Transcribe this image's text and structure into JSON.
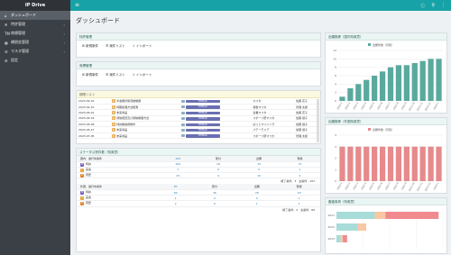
{
  "app": {
    "brand": "IP Drive"
  },
  "sidebar": {
    "items": [
      {
        "icon": "⌂",
        "label": "ダッシュボード",
        "active": true,
        "chevron": false
      },
      {
        "icon": "✉",
        "label": "特許管理",
        "active": false,
        "chevron": true
      },
      {
        "icon": "TM",
        "label": "商標管理",
        "active": false,
        "chevron": true
      },
      {
        "icon": "▦",
        "label": "補償金管理",
        "active": false,
        "chevron": true
      },
      {
        "icon": "☰",
        "label": "マスタ管理",
        "active": false,
        "chevron": true
      },
      {
        "icon": "⚙",
        "label": "設定",
        "active": false,
        "chevron": false
      }
    ]
  },
  "topbar": {
    "menu_icon": "≡",
    "icons": [
      "ⓘ",
      "♀",
      "⋮"
    ]
  },
  "page": {
    "title": "ダッシュボード"
  },
  "patent_panel": {
    "title": "特許管理",
    "links": [
      "新規案件",
      "案件リスト",
      "インポート"
    ]
  },
  "trademark_panel": {
    "title": "商標管理",
    "links": [
      "新規案件",
      "案件リスト",
      "インポート"
    ]
  },
  "deadline_panel": {
    "title": "期限リスト",
    "rows": [
      {
        "date": "2023-02-01",
        "name": "半金属状態流動制御",
        "code": "TRYMAR",
        "person": "マスタ",
        "owner": "佐藤 花子"
      },
      {
        "date": "2023-02-10",
        "name": "特願処理方法観測",
        "code": "TRYMAR",
        "person": "報告マスタ",
        "owner": "管理 太郎"
      },
      {
        "date": "2023-04-01",
        "name": "未来商品",
        "code": "TRYMAR",
        "person": "企業マスタ",
        "owner": "佐藤 花子"
      },
      {
        "date": "2023-04-16",
        "name": "通信装置及び通信制御方法",
        "code": "TRYMAR",
        "person": "スポーツ研マスタ",
        "owner": "加藤 健子"
      },
      {
        "date": "2023-05-06",
        "name": "特許推進用物件",
        "code": "TRYMAR",
        "person": "ぱっとマイニング",
        "owner": "加藤 健子"
      },
      {
        "date": "2023-05-27",
        "name": "未来商品",
        "code": "TRYMAR",
        "person": "パテーモミア",
        "owner": "加藤 健子"
      },
      {
        "date": "2023-07-05",
        "name": "未来商品",
        "code": "TRYMAR",
        "person": "スポーツ研マスタ",
        "owner": "管理 太郎"
      }
    ]
  },
  "status_panel": {
    "title": "ステータス別件数（特実意）",
    "domestic": {
      "header": {
        "label": "国内：進行中案件",
        "total": "193",
        "c1": "受付",
        "c2": "出願",
        "c3": "登録"
      },
      "rows": [
        {
          "tag": "B",
          "tag_color": "#7a5fb8",
          "label": "特許",
          "total": "169",
          "c1": "18",
          "c2": "79",
          "c3": "72"
        },
        {
          "tag": "J",
          "tag_color": "#e6a23c",
          "label": "実案",
          "total": "1",
          "c1": "0",
          "c2": "0",
          "c3": "1"
        },
        {
          "tag": "D",
          "tag_color": "#e67e22",
          "label": "意匠",
          "total": "23",
          "c1": "4",
          "c2": "15",
          "c3": "4"
        }
      ],
      "footer": "終了案件：3　全案件：197"
    },
    "foreign": {
      "header": {
        "label": "外国：進行中案件",
        "total": "87",
        "c1": "受付",
        "c2": "出願",
        "c3": "登録"
      },
      "rows": [
        {
          "tag": "B",
          "tag_color": "#7a5fb8",
          "label": "特許",
          "total": "84",
          "c1": "36",
          "c2": "28",
          "c3": "18"
        },
        {
          "tag": "J",
          "tag_color": "#e6a23c",
          "label": "実案",
          "total": "1",
          "c1": "0",
          "c2": "0",
          "c3": "1"
        },
        {
          "tag": "D",
          "tag_color": "#e67e22",
          "label": "意匠",
          "total": "2",
          "c1": "0",
          "c2": "1",
          "c3": "1"
        }
      ],
      "footer": "終了案件：2　全案件：89"
    }
  },
  "chart1_panel": {
    "title": "出願推移（国内特実意）"
  },
  "chart2_panel": {
    "title": "出願推移（外国特実意）"
  },
  "chart3_panel": {
    "title": "審査負荷（特実意）"
  },
  "chart_data": [
    {
      "type": "bar",
      "title": "出願推移（国内特実意）",
      "legend": "出願件数（月別）",
      "categories": [
        "2022-1",
        "2022-2",
        "2022-3",
        "2022-4",
        "2022-5",
        "2022-6",
        "2022-7",
        "2022-8",
        "2022-9",
        "2022-10",
        "2022-11",
        "2022-12",
        "2023-1"
      ],
      "values": [
        1,
        3,
        4,
        5,
        6,
        7,
        8,
        8.5,
        8.5,
        9,
        9.5,
        10,
        10
      ],
      "ylim": [
        0,
        12
      ],
      "yticks": [
        "0",
        "2",
        "4",
        "6",
        "8",
        "10",
        "12"
      ],
      "color": "#5aa99e"
    },
    {
      "type": "bar",
      "title": "出願推移（外国特実意）",
      "legend": "出願件数（月別）",
      "categories": [
        "2022-1",
        "2022-2",
        "2022-3",
        "2022-4",
        "2022-5",
        "2022-6",
        "2022-7",
        "2022-8",
        "2022-9",
        "2022-10",
        "2022-11",
        "2022-12",
        "2023-1"
      ],
      "values": [
        3,
        3,
        3,
        3,
        3,
        3,
        3,
        3,
        3,
        3,
        3,
        3,
        3
      ],
      "ylim": [
        0,
        4
      ],
      "yticks": [
        "0",
        "1",
        "2",
        "3",
        "4"
      ],
      "color": "#e68a8c"
    },
    {
      "type": "bar",
      "orientation": "horizontal",
      "stacked": true,
      "title": "審査負荷（特実意）",
      "categories": [
        "2021",
        "2022",
        "2023"
      ],
      "series": [
        {
          "values": [
            18,
            10,
            2
          ],
          "color": "#a8dcd9"
        },
        {
          "values": [
            5,
            4,
            1
          ],
          "color": "#f8c8a4"
        },
        {
          "values": [
            25,
            0,
            2
          ],
          "color": "#f08a8f"
        }
      ],
      "xlim": [
        0,
        50
      ]
    }
  ]
}
